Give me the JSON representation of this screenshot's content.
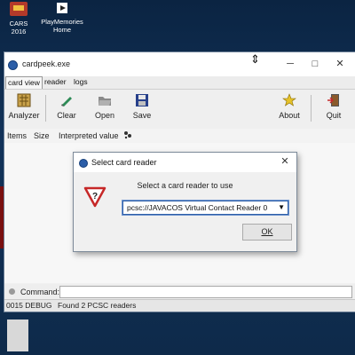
{
  "desktop": {
    "icons": [
      {
        "label": "CARS 2016",
        "icon": "game-icon"
      },
      {
        "label": "PlayMemories Home",
        "icon": "playmemories-icon"
      }
    ]
  },
  "window": {
    "title": "cardpeek.exe",
    "controls": {
      "minimize": "─",
      "maximize": "□",
      "close": "✕"
    }
  },
  "menu": {
    "tabs": [
      "card view",
      "reader",
      "logs"
    ],
    "active_tab": "card view"
  },
  "toolbar": {
    "analyzer": "Analyzer",
    "clear": "Clear",
    "open": "Open",
    "save": "Save",
    "about": "About",
    "quit": "Quit"
  },
  "columns": {
    "items": "Items",
    "size": "Size",
    "interpreted": "Interpreted value"
  },
  "command": {
    "label": "Command:",
    "value": ""
  },
  "status": {
    "code": "0015 DEBUG",
    "message": "Found 2 PCSC readers"
  },
  "dialog": {
    "title": "Select card reader",
    "close": "✕",
    "message": "Select a card reader to use",
    "selected_reader": "pcsc://JAVACOS Virtual Contact Reader 0",
    "ok_label": "OK"
  },
  "colors": {
    "desktop": "#0d2b4a",
    "window_bg": "#f0f0f0",
    "focus_border": "#2f5fa8",
    "warning_red": "#c62828"
  }
}
